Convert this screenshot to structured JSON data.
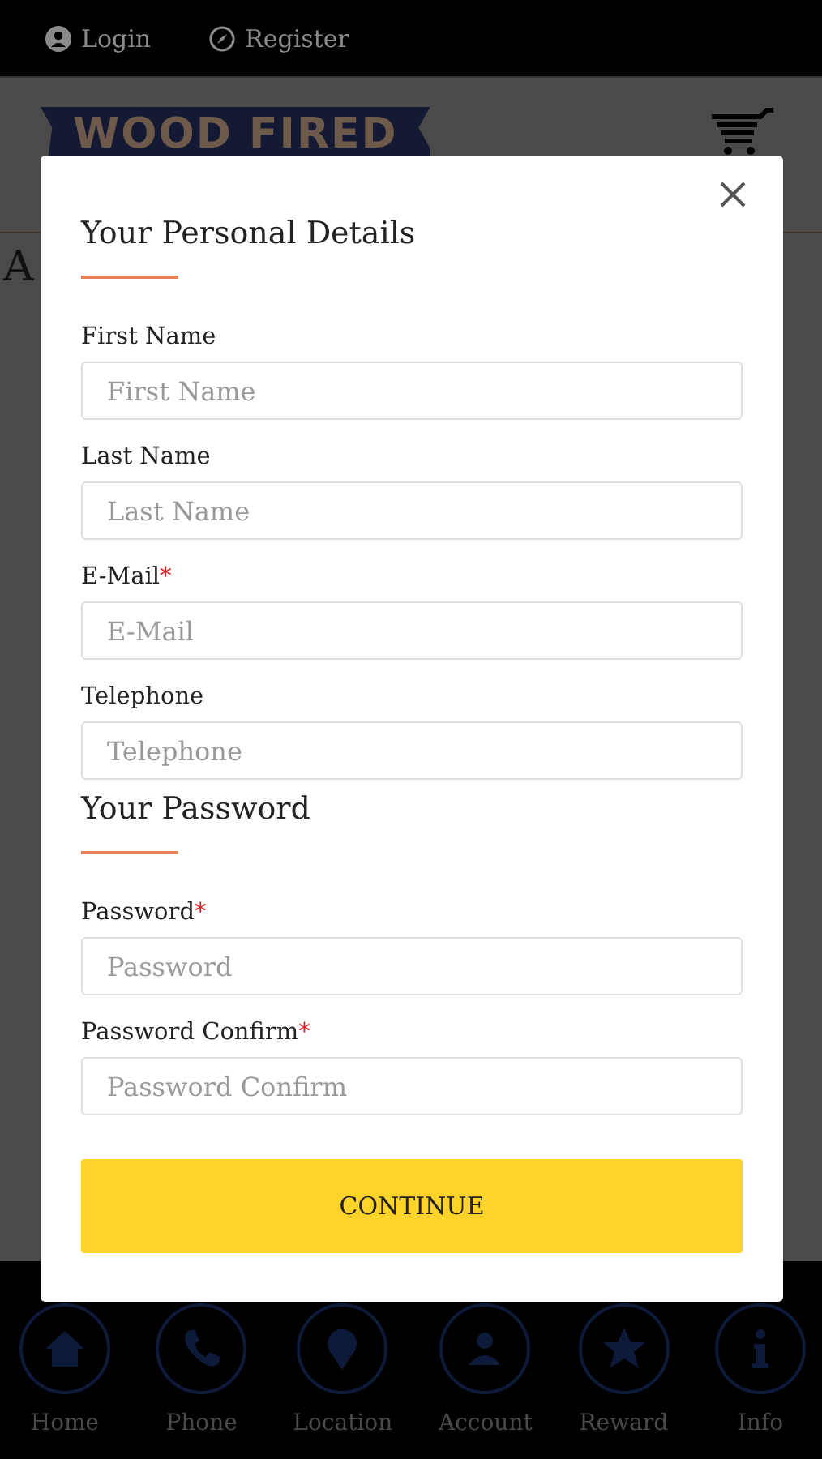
{
  "top_bar": {
    "links": [
      {
        "label": "Login",
        "kind": "user"
      },
      {
        "label": "Register",
        "kind": "compass"
      }
    ]
  },
  "header": {
    "logo": "WOOD FIRED"
  },
  "page": {
    "heading": "A"
  },
  "modal": {
    "sections": [
      {
        "title": "Your Personal Details",
        "fields": [
          {
            "label": "First Name",
            "placeholder": "First Name"
          },
          {
            "label": "Last Name",
            "placeholder": "Last Name"
          },
          {
            "label": "E-Mail",
            "required_mark": "*",
            "placeholder": "E-Mail"
          },
          {
            "label": "Telephone",
            "placeholder": "Telephone"
          }
        ]
      },
      {
        "title": "Your Password",
        "fields": [
          {
            "label": "Password",
            "required_mark": "*",
            "placeholder": "Password"
          },
          {
            "label": "Password Confirm",
            "required_mark": "*",
            "placeholder": "Password Confirm"
          }
        ]
      }
    ],
    "button": "CONTINUE"
  },
  "bottom_nav": [
    {
      "label": "Home",
      "kind": "home"
    },
    {
      "label": "Phone",
      "kind": "phone"
    },
    {
      "label": "Location",
      "kind": "location"
    },
    {
      "label": "Account",
      "kind": "account"
    },
    {
      "label": "Reward",
      "kind": "reward"
    },
    {
      "label": "Info",
      "kind": "info"
    }
  ]
}
